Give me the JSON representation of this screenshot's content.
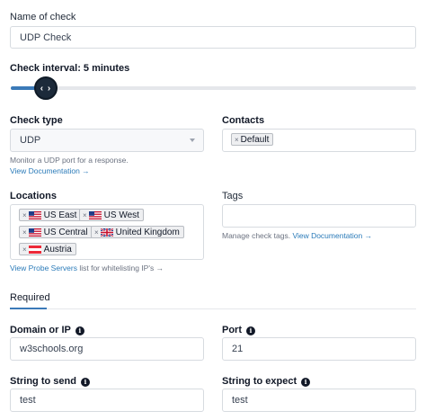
{
  "name_field": {
    "label": "Name of check",
    "value": "UDP Check"
  },
  "interval": {
    "label": "Check interval: 5 minutes",
    "handle_glyph": "‹ ›",
    "level_fraction": 0.08
  },
  "check_type": {
    "label": "Check type",
    "selected": "UDP",
    "help": "Monitor a UDP port for a response.",
    "doc_link": "View Documentation →"
  },
  "contacts": {
    "label": "Contacts",
    "chips": [
      "Default"
    ]
  },
  "locations": {
    "label": "Locations",
    "chips": [
      {
        "name": "US East",
        "flag": "us"
      },
      {
        "name": "US West",
        "flag": "us"
      },
      {
        "name": "US Central",
        "flag": "us"
      },
      {
        "name": "United Kingdom",
        "flag": "uk"
      },
      {
        "name": "Austria",
        "flag": "at"
      }
    ],
    "probe_link": "View Probe Servers",
    "probe_suffix": " list for whitelisting IP's →"
  },
  "tags": {
    "label": "Tags",
    "help": "Manage check tags. ",
    "doc_link": "View Documentation →"
  },
  "tabs": [
    {
      "label": "Required",
      "active": true
    }
  ],
  "domain": {
    "label": "Domain or IP",
    "value": "w3schools.org"
  },
  "port": {
    "label": "Port",
    "value": "21"
  },
  "string_send": {
    "label": "String to send",
    "value": "test"
  },
  "string_expect": {
    "label": "String to expect",
    "value": "test"
  },
  "chip_remove_glyph": "×",
  "info_glyph": "i",
  "colors": {
    "accent": "#3b7ab8",
    "link": "#2b7bb9",
    "handle": "#1c2a3a"
  }
}
